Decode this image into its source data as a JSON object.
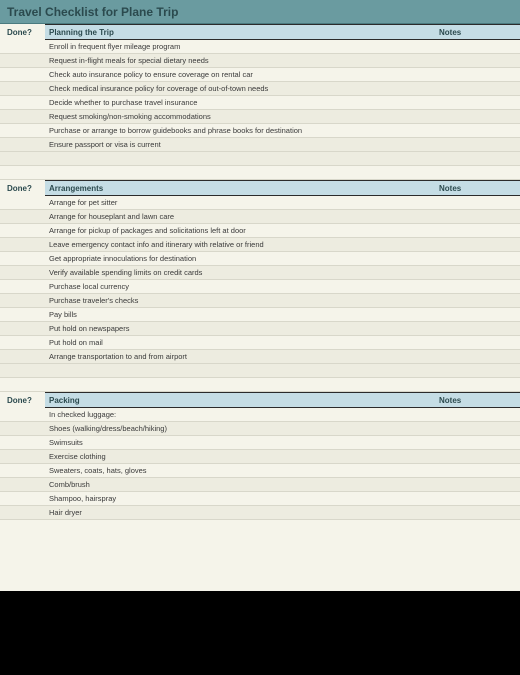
{
  "title": "Travel Checklist for Plane Trip",
  "columns": {
    "done": "Done?",
    "notes": "Notes"
  },
  "sections": [
    {
      "name": "Planning the Trip",
      "items": [
        "Enroll in frequent flyer mileage program",
        "Request in-flight meals for special dietary needs",
        "Check auto insurance policy to ensure coverage on rental car",
        "Check medical insurance policy for coverage of out-of-town needs",
        "Decide whether to purchase travel insurance",
        "Request smoking/non-smoking accommodations",
        "Purchase or arrange to borrow guidebooks and phrase books for destination",
        "Ensure passport or visa is current"
      ]
    },
    {
      "name": "Arrangements",
      "items": [
        "Arrange for pet sitter",
        "Arrange for houseplant and lawn care",
        "Arrange for pickup of packages and solicitations left at door",
        "Leave emergency contact info and itinerary with relative or friend",
        "Get appropriate innoculations for destination",
        "Verify available spending limits on credit cards",
        "Purchase local currency",
        "Purchase traveler's checks",
        "Pay bills",
        "Put hold on newspapers",
        "Put hold on mail",
        "Arrange transportation to and from airport"
      ]
    },
    {
      "name": "Packing",
      "items": [
        "In checked luggage:",
        "Shoes (walking/dress/beach/hiking)",
        "Swimsuits",
        "Exercise clothing",
        "Sweaters, coats, hats, gloves",
        "Comb/brush",
        "Shampoo, hairspray",
        "Hair dryer"
      ]
    }
  ]
}
